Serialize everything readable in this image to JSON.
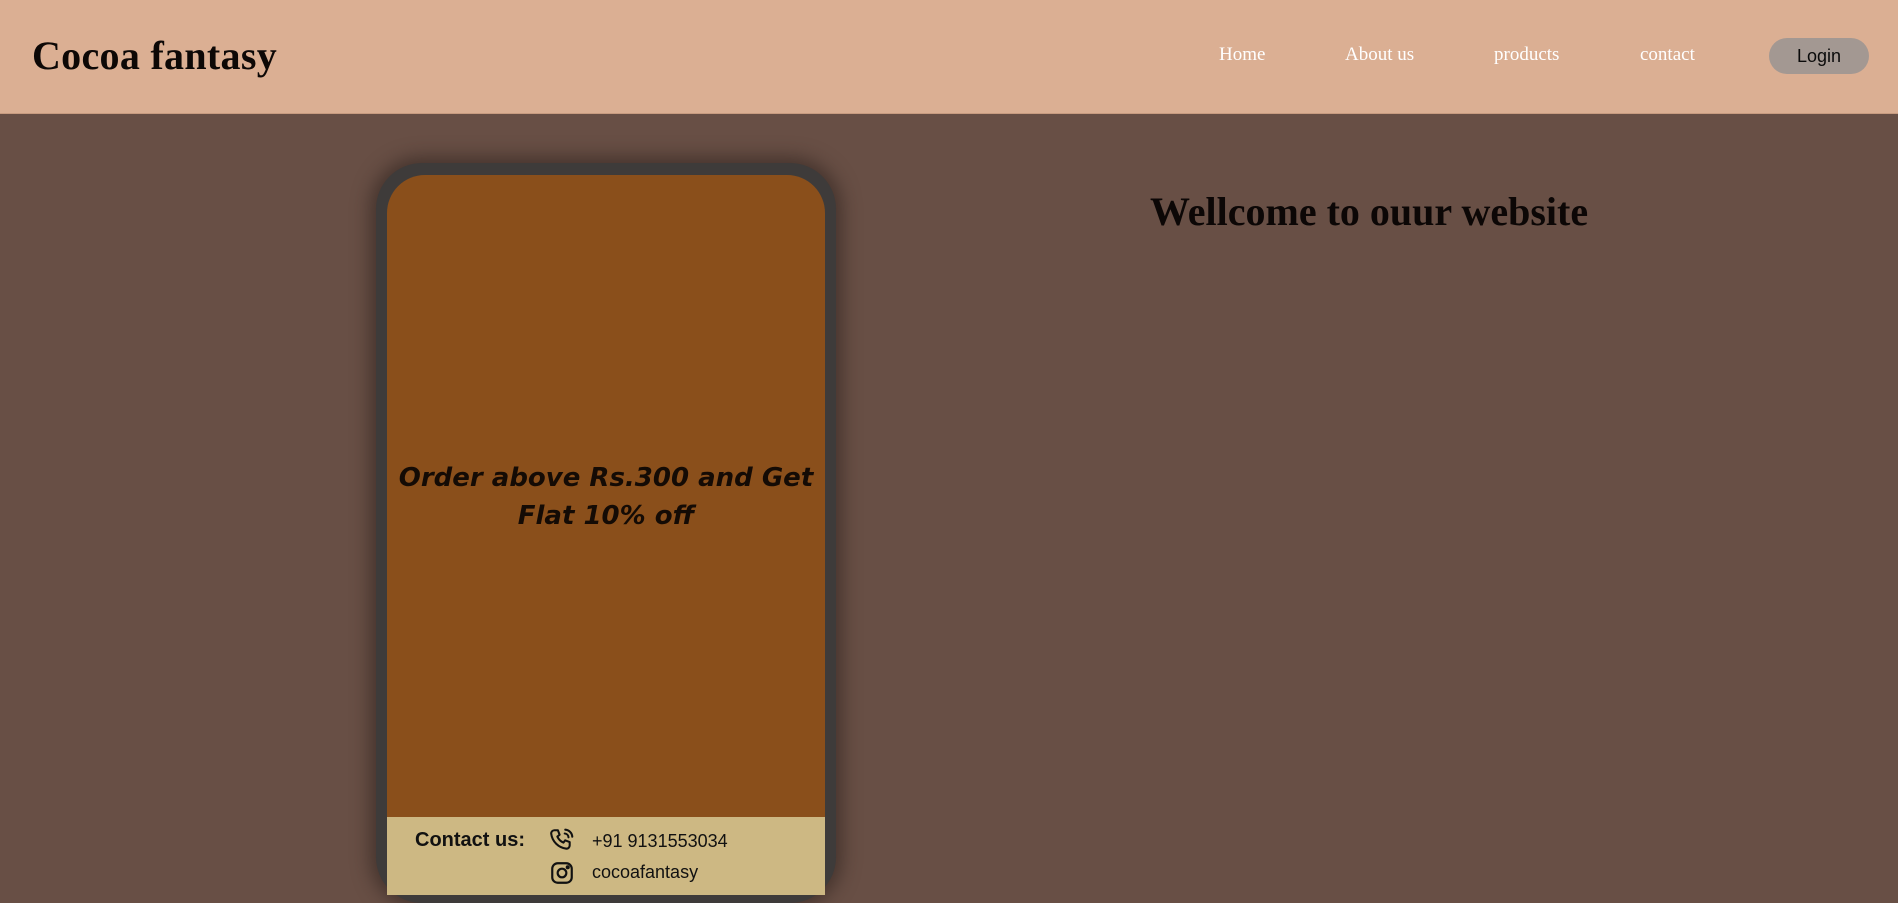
{
  "header": {
    "brand": "Cocoa fantasy",
    "nav": [
      {
        "label": "Home"
      },
      {
        "label": "About us"
      },
      {
        "label": "products"
      },
      {
        "label": "contact"
      }
    ],
    "login_label": "Login"
  },
  "promo": {
    "text": "Order above Rs.300 and Get Flat 10% off"
  },
  "contact": {
    "label": "Contact us:",
    "phone": "+91 9131553034",
    "instagram": "cocoafantasy",
    "icons": [
      "phone-icon",
      "instagram-icon"
    ]
  },
  "main": {
    "welcome": "Wellcome to ouur website"
  },
  "colors": {
    "header_bg": "#dbaf93",
    "page_bg": "#684f45",
    "phone_frame": "#3e3b3a",
    "promo_bg": "#8a4f1b",
    "contact_bg": "#cdb883",
    "login_bg": "#a39892"
  }
}
